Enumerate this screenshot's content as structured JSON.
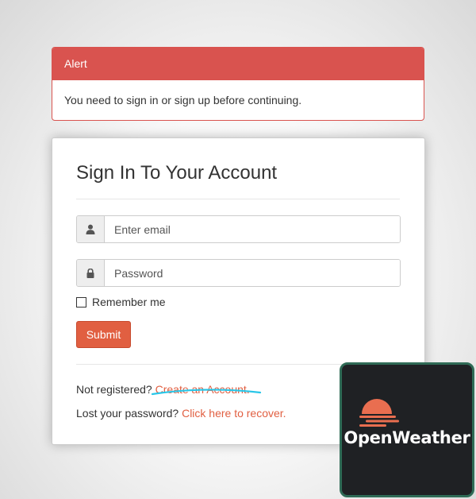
{
  "alert": {
    "title": "Alert",
    "message": "You need to sign in or sign up before continuing."
  },
  "signin": {
    "title": "Sign In To Your Account",
    "email_placeholder": "Enter email",
    "password_placeholder": "Password",
    "remember_label": "Remember me",
    "submit_label": "Submit",
    "not_registered": "Not registered?",
    "create_account": "Create an Account.",
    "lost_password": "Lost your password?",
    "recover": "Click here to recover."
  },
  "logo": {
    "name": "OpenWeather"
  },
  "colors": {
    "alert_red": "#d9534f",
    "brand_orange": "#e15f41",
    "highlight_cyan": "#29c6e8",
    "logo_bg": "#1f2124",
    "logo_border": "#2f6b56"
  },
  "icons": {
    "email_addon": "user-icon",
    "password_addon": "lock-icon"
  }
}
